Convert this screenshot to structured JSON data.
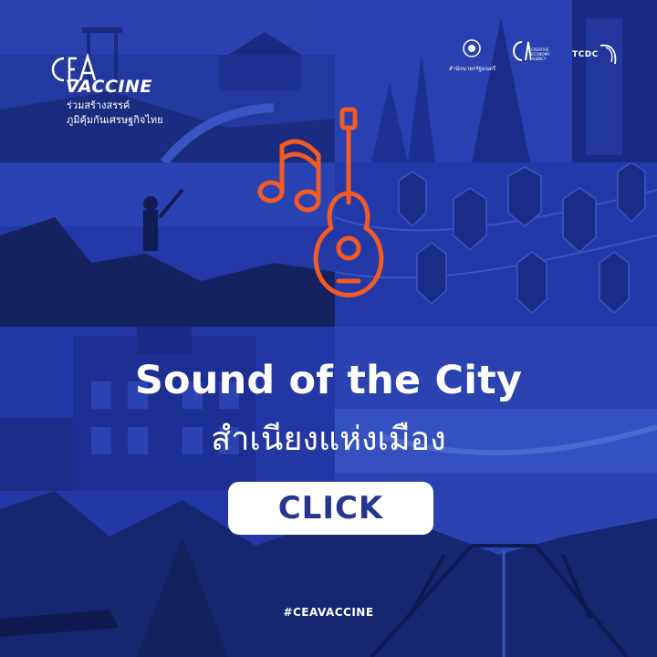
{
  "brand": {
    "wordmark": "VACCINE",
    "tagline_line1": "ร่วมสร้างสรรค์",
    "tagline_line2": "ภูมิคุ้มกันเศรษฐกิจไทย"
  },
  "partners": {
    "government_label": "สำนักนายกรัฐมนตรี",
    "cea_sub": "CREATIVE ECONOMY AGENCY",
    "tcdc_label": "TCDC"
  },
  "headline": "Sound of the City",
  "subheadline": "สำเนียงแห่งเมือง",
  "cta_label": "CLICK",
  "hashtag": "#CEAVACCINE",
  "colors": {
    "tint": "#2136a3",
    "icon_accent": "#f15a22",
    "cta_background": "#ffffff",
    "cta_text": "#24368f"
  },
  "icons": {
    "center": "music-notes-guitar-icon",
    "brand": "cea-logo-icon",
    "partners": [
      "government-seal-icon",
      "cea-logo-icon",
      "tcdc-logo-icon"
    ]
  }
}
